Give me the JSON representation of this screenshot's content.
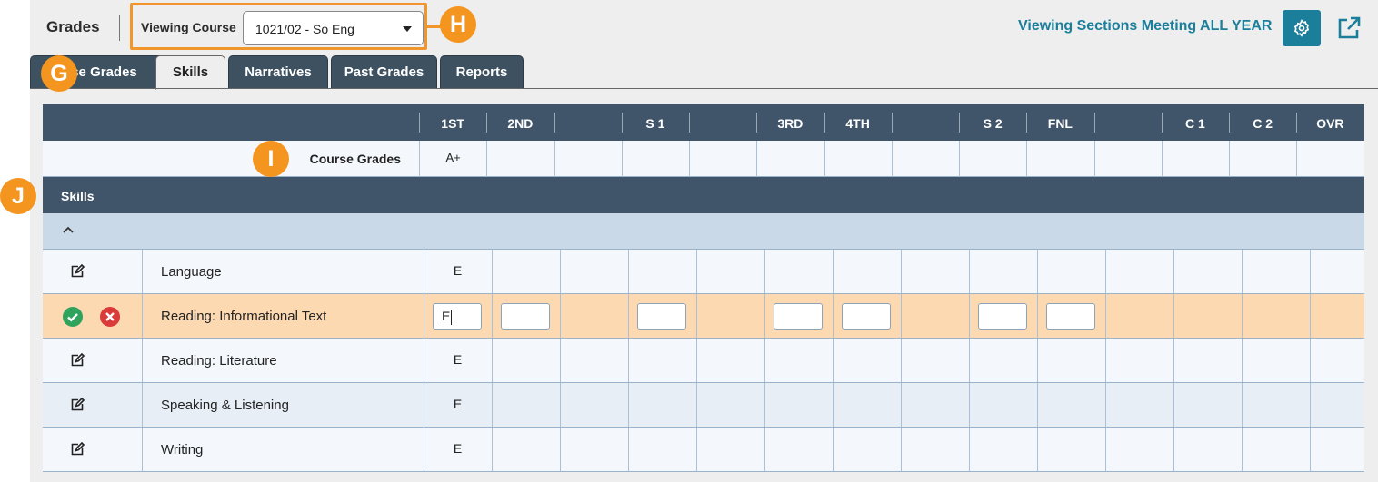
{
  "header": {
    "title": "Grades",
    "viewing_course_label": "Viewing Course",
    "course_value": "1021/02 - So Eng",
    "viewing_sections": "Viewing Sections Meeting ALL YEAR"
  },
  "callouts": {
    "g": "G",
    "h": "H",
    "i": "I",
    "j": "J"
  },
  "tabs": [
    {
      "label": "se Grades",
      "active": false
    },
    {
      "label": "Skills",
      "active": true
    },
    {
      "label": "Narratives",
      "active": false
    },
    {
      "label": "Past Grades",
      "active": false
    },
    {
      "label": "Reports",
      "active": false
    }
  ],
  "table": {
    "columns": [
      "1ST",
      "2ND",
      "",
      "S 1",
      "",
      "3RD",
      "4TH",
      "",
      "S 2",
      "FNL",
      "",
      "C 1",
      "C 2",
      "OVR"
    ],
    "course_grades_label": "Course Grades",
    "course_grades_values": [
      "A+",
      "",
      "",
      "",
      "",
      "",
      "",
      "",
      "",
      "",
      "",
      "",
      "",
      ""
    ],
    "skills_label": "Skills",
    "skills": [
      {
        "name": "Language",
        "values": [
          "E",
          "",
          "",
          "",
          "",
          "",
          "",
          "",
          "",
          "",
          "",
          "",
          "",
          ""
        ]
      },
      {
        "name": "Reading: Informational Text",
        "editing": true,
        "input_value": "E"
      },
      {
        "name": "Reading: Literature",
        "values": [
          "E",
          "",
          "",
          "",
          "",
          "",
          "",
          "",
          "",
          "",
          "",
          "",
          "",
          ""
        ]
      },
      {
        "name": "Speaking & Listening",
        "values": [
          "E",
          "",
          "",
          "",
          "",
          "",
          "",
          "",
          "",
          "",
          "",
          "",
          "",
          ""
        ]
      },
      {
        "name": "Writing",
        "values": [
          "E",
          "",
          "",
          "",
          "",
          "",
          "",
          "",
          "",
          "",
          "",
          "",
          "",
          ""
        ]
      }
    ]
  },
  "colors": {
    "accent": "#1b7e9a",
    "header_bg": "#41556a",
    "callout": "#f3951f",
    "edit_row": "#fdd9b2"
  },
  "icons": {
    "gear": "gear-icon",
    "external": "external-link-icon",
    "edit": "edit-icon",
    "save": "check-circle-icon",
    "cancel": "x-circle-icon",
    "collapse": "chevron-up-icon",
    "dropdown": "caret-down-icon"
  }
}
